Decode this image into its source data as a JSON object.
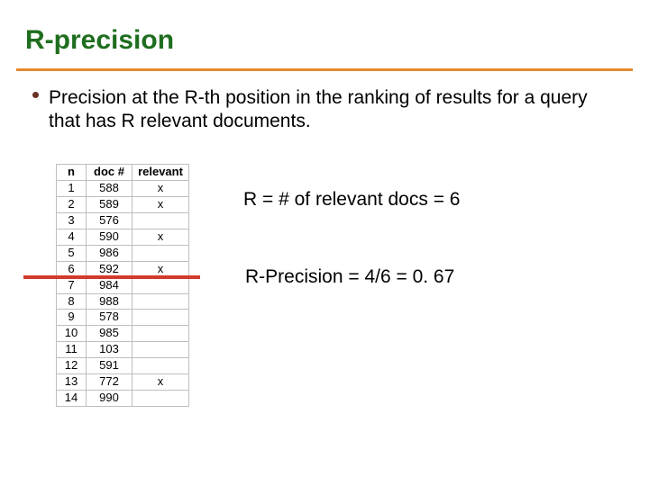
{
  "title": "R-precision",
  "bullet": "Precision at the R-th position in the ranking of results for a query that has R relevant documents.",
  "table": {
    "headers": [
      "n",
      "doc #",
      "relevant"
    ],
    "rows": [
      {
        "n": "1",
        "doc": "588",
        "rel": "x"
      },
      {
        "n": "2",
        "doc": "589",
        "rel": "x"
      },
      {
        "n": "3",
        "doc": "576",
        "rel": ""
      },
      {
        "n": "4",
        "doc": "590",
        "rel": "x"
      },
      {
        "n": "5",
        "doc": "986",
        "rel": ""
      },
      {
        "n": "6",
        "doc": "592",
        "rel": "x"
      },
      {
        "n": "7",
        "doc": "984",
        "rel": ""
      },
      {
        "n": "8",
        "doc": "988",
        "rel": ""
      },
      {
        "n": "9",
        "doc": "578",
        "rel": ""
      },
      {
        "n": "10",
        "doc": "985",
        "rel": ""
      },
      {
        "n": "11",
        "doc": "103",
        "rel": ""
      },
      {
        "n": "12",
        "doc": "591",
        "rel": ""
      },
      {
        "n": "13",
        "doc": "772",
        "rel": "x"
      },
      {
        "n": "14",
        "doc": "990",
        "rel": ""
      }
    ]
  },
  "cutoff_after_row": 6,
  "annotations": {
    "r_line": "R = # of relevant docs = 6",
    "rp_line": "R-Precision = 4/6 = 0. 67"
  }
}
